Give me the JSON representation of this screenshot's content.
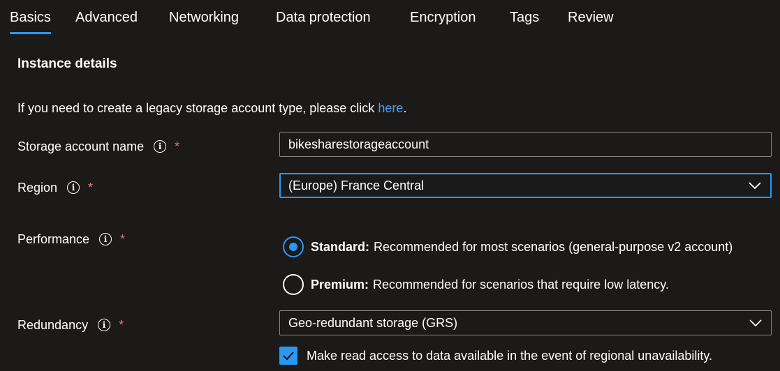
{
  "tabs": [
    {
      "label": "Basics",
      "active": true
    },
    {
      "label": "Advanced"
    },
    {
      "label": "Networking"
    },
    {
      "label": "Data protection"
    },
    {
      "label": "Encryption"
    },
    {
      "label": "Tags"
    },
    {
      "label": "Review"
    }
  ],
  "section": {
    "title": "Instance details"
  },
  "legacy": {
    "text": "If you need to create a legacy storage account type, please click ",
    "link": "here",
    "suffix": "."
  },
  "fields": {
    "storage_name": {
      "label": "Storage account name",
      "value": "bikesharestorageaccount",
      "required": "*"
    },
    "region": {
      "label": "Region",
      "value": "(Europe) France Central",
      "required": "*"
    },
    "performance": {
      "label": "Performance",
      "required": "*",
      "options": [
        {
          "title": "Standard:",
          "desc": "Recommended for most scenarios (general-purpose v2 account)",
          "selected": true
        },
        {
          "title": "Premium:",
          "desc": "Recommended for scenarios that require low latency.",
          "selected": false
        }
      ]
    },
    "redundancy": {
      "label": "Redundancy",
      "value": "Geo-redundant storage (GRS)",
      "required": "*",
      "checkbox_label": "Make read access to data available in the event of regional unavailability.",
      "checked": true
    }
  },
  "info_icon_glyph": "i",
  "colors": {
    "accent": "#2899f5",
    "required": "#f1707b",
    "link": "#479ef5",
    "background": "#1b1a19"
  }
}
